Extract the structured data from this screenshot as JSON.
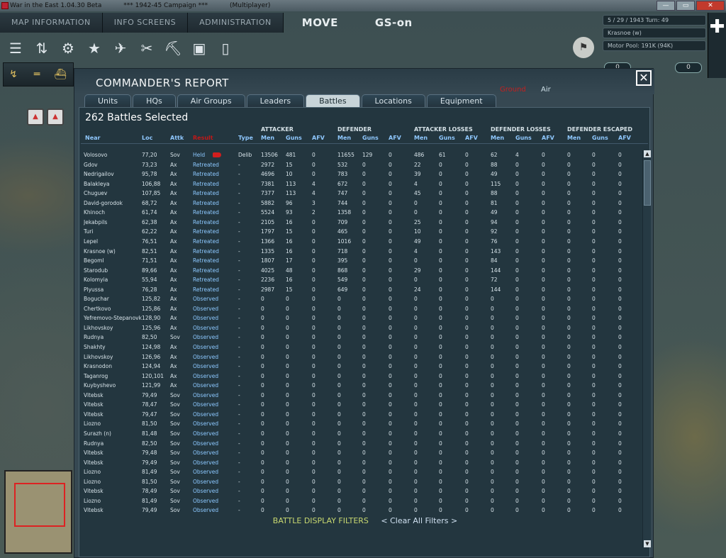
{
  "window": {
    "title": "War in the East 1.04.30 Beta",
    "campaign": "***   1942-45 Campaign   ***",
    "mode": "(Multiplayer)",
    "buttons": [
      "—",
      "▭",
      "✕"
    ]
  },
  "top_menu": {
    "tabs": [
      "MAP INFORMATION",
      "INFO SCREENS",
      "ADMINISTRATION"
    ],
    "move": "MOVE",
    "gs": "GS-on"
  },
  "info_panel": {
    "date_turn": "5 / 29 / 1943      Turn: 49",
    "location": "Krasnoe (w)",
    "motor_pool": "Motor Pool: 191K (94K)",
    "pill_left": "0",
    "pill_right": "0"
  },
  "toolbar_icons": [
    "list-icon",
    "sliders-icon",
    "gear-icon",
    "star-icon",
    "aircraft-icon",
    "supply-icon",
    "rail-icon",
    "card-icon",
    "document-icon"
  ],
  "dialog": {
    "title": "COMMANDER'S REPORT",
    "modes": {
      "ground": "Ground",
      "air": "Air"
    },
    "close": "✕",
    "tabs": [
      "Units",
      "HQs",
      "Air Groups",
      "Leaders",
      "Battles",
      "Locations",
      "Equipment"
    ],
    "active_tab": "Battles",
    "selected_count": "262 Battles Selected",
    "groups": {
      "attacker": "ATTACKER",
      "defender": "DEFENDER",
      "attacker_losses": "ATTACKER LOSSES",
      "defender_losses": "DEFENDER LOSSES",
      "defender_escaped": "DEFENDER ESCAPED"
    },
    "columns": {
      "near": "Near",
      "loc": "Loc",
      "attk": "Attk",
      "result": "Result",
      "type": "Type",
      "men": "Men",
      "guns": "Guns",
      "afv": "AFV"
    },
    "filters": {
      "display": "BATTLE DISPLAY FILTERS",
      "clear": "< Clear All Filters >"
    }
  },
  "battles": [
    [
      "Volosovo",
      "77,20",
      "Sov",
      "Held",
      "Delib",
      "13506",
      "481",
      "0",
      "11655",
      "129",
      "0",
      "486",
      "61",
      "0",
      "62",
      "4",
      "0",
      "0",
      "0",
      "0"
    ],
    [
      "Gdov",
      "73,23",
      "Ax",
      "Retreated",
      "-",
      "2972",
      "15",
      "0",
      "532",
      "0",
      "0",
      "22",
      "0",
      "0",
      "88",
      "0",
      "0",
      "0",
      "0",
      "0"
    ],
    [
      "Nedrigailov",
      "95,78",
      "Ax",
      "Retreated",
      "-",
      "4696",
      "10",
      "0",
      "783",
      "0",
      "0",
      "39",
      "0",
      "0",
      "49",
      "0",
      "0",
      "0",
      "0",
      "0"
    ],
    [
      "Balakleya",
      "106,88",
      "Ax",
      "Retreated",
      "-",
      "7381",
      "113",
      "4",
      "672",
      "0",
      "0",
      "4",
      "0",
      "0",
      "115",
      "0",
      "0",
      "0",
      "0",
      "0"
    ],
    [
      "Chuguev",
      "107,85",
      "Ax",
      "Retreated",
      "-",
      "7377",
      "113",
      "4",
      "747",
      "0",
      "0",
      "45",
      "0",
      "0",
      "88",
      "0",
      "0",
      "0",
      "0",
      "0"
    ],
    [
      "David-gorodok",
      "68,72",
      "Ax",
      "Retreated",
      "-",
      "5882",
      "96",
      "3",
      "744",
      "0",
      "0",
      "0",
      "0",
      "0",
      "81",
      "0",
      "0",
      "0",
      "0",
      "0"
    ],
    [
      "Khinoch",
      "61,74",
      "Ax",
      "Retreated",
      "-",
      "5524",
      "93",
      "2",
      "1358",
      "0",
      "0",
      "0",
      "0",
      "0",
      "49",
      "0",
      "0",
      "0",
      "0",
      "0"
    ],
    [
      "Jekabpils",
      "62,38",
      "Ax",
      "Retreated",
      "-",
      "2105",
      "16",
      "0",
      "709",
      "0",
      "0",
      "25",
      "0",
      "0",
      "94",
      "0",
      "0",
      "0",
      "0",
      "0"
    ],
    [
      "Turi",
      "62,22",
      "Ax",
      "Retreated",
      "-",
      "1797",
      "15",
      "0",
      "465",
      "0",
      "0",
      "10",
      "0",
      "0",
      "92",
      "0",
      "0",
      "0",
      "0",
      "0"
    ],
    [
      "Lepel",
      "76,51",
      "Ax",
      "Retreated",
      "-",
      "1366",
      "16",
      "0",
      "1016",
      "0",
      "0",
      "49",
      "0",
      "0",
      "76",
      "0",
      "0",
      "0",
      "0",
      "0"
    ],
    [
      "Krasnoe (w)",
      "82,51",
      "Ax",
      "Retreated",
      "-",
      "1335",
      "16",
      "0",
      "718",
      "0",
      "0",
      "4",
      "0",
      "0",
      "143",
      "0",
      "0",
      "0",
      "0",
      "0"
    ],
    [
      "Begoml",
      "71,51",
      "Ax",
      "Retreated",
      "-",
      "1807",
      "17",
      "0",
      "395",
      "0",
      "0",
      "0",
      "0",
      "0",
      "84",
      "0",
      "0",
      "0",
      "0",
      "0"
    ],
    [
      "Starodub",
      "89,66",
      "Ax",
      "Retreated",
      "-",
      "4025",
      "48",
      "0",
      "868",
      "0",
      "0",
      "29",
      "0",
      "0",
      "144",
      "0",
      "0",
      "0",
      "0",
      "0"
    ],
    [
      "Kolomyia",
      "55,94",
      "Ax",
      "Retreated",
      "-",
      "2236",
      "16",
      "0",
      "549",
      "0",
      "0",
      "0",
      "0",
      "0",
      "72",
      "0",
      "0",
      "0",
      "0",
      "0"
    ],
    [
      "Plyussa",
      "76,28",
      "Ax",
      "Retreated",
      "-",
      "2987",
      "15",
      "0",
      "649",
      "0",
      "0",
      "24",
      "0",
      "0",
      "144",
      "0",
      "0",
      "0",
      "0",
      "0"
    ],
    [
      "Boguchar",
      "125,82",
      "Ax",
      "Observed",
      "-",
      "0",
      "0",
      "0",
      "0",
      "0",
      "0",
      "0",
      "0",
      "0",
      "0",
      "0",
      "0",
      "0",
      "0",
      "0"
    ],
    [
      "Chertkovo",
      "125,86",
      "Ax",
      "Observed",
      "-",
      "0",
      "0",
      "0",
      "0",
      "0",
      "0",
      "0",
      "0",
      "0",
      "0",
      "0",
      "0",
      "0",
      "0",
      "0"
    ],
    [
      "Yefremovo-Stepanovka",
      "128,90",
      "Ax",
      "Observed",
      "-",
      "0",
      "0",
      "0",
      "0",
      "0",
      "0",
      "0",
      "0",
      "0",
      "0",
      "0",
      "0",
      "0",
      "0",
      "0"
    ],
    [
      "Likhovskoy",
      "125,96",
      "Ax",
      "Observed",
      "-",
      "0",
      "0",
      "0",
      "0",
      "0",
      "0",
      "0",
      "0",
      "0",
      "0",
      "0",
      "0",
      "0",
      "0",
      "0"
    ],
    [
      "Rudnya",
      "82,50",
      "Sov",
      "Observed",
      "-",
      "0",
      "0",
      "0",
      "0",
      "0",
      "0",
      "0",
      "0",
      "0",
      "0",
      "0",
      "0",
      "0",
      "0",
      "0"
    ],
    [
      "Shakhty",
      "124,98",
      "Ax",
      "Observed",
      "-",
      "0",
      "0",
      "0",
      "0",
      "0",
      "0",
      "0",
      "0",
      "0",
      "0",
      "0",
      "0",
      "0",
      "0",
      "0"
    ],
    [
      "Likhovskoy",
      "126,96",
      "Ax",
      "Observed",
      "-",
      "0",
      "0",
      "0",
      "0",
      "0",
      "0",
      "0",
      "0",
      "0",
      "0",
      "0",
      "0",
      "0",
      "0",
      "0"
    ],
    [
      "Krasnodon",
      "124,94",
      "Ax",
      "Observed",
      "-",
      "0",
      "0",
      "0",
      "0",
      "0",
      "0",
      "0",
      "0",
      "0",
      "0",
      "0",
      "0",
      "0",
      "0",
      "0"
    ],
    [
      "Taganrog",
      "120,101",
      "Ax",
      "Observed",
      "-",
      "0",
      "0",
      "0",
      "0",
      "0",
      "0",
      "0",
      "0",
      "0",
      "0",
      "0",
      "0",
      "0",
      "0",
      "0"
    ],
    [
      "Kuybyshevo",
      "121,99",
      "Ax",
      "Observed",
      "-",
      "0",
      "0",
      "0",
      "0",
      "0",
      "0",
      "0",
      "0",
      "0",
      "0",
      "0",
      "0",
      "0",
      "0",
      "0"
    ],
    [
      "Vitebsk",
      "79,49",
      "Sov",
      "Observed",
      "-",
      "0",
      "0",
      "0",
      "0",
      "0",
      "0",
      "0",
      "0",
      "0",
      "0",
      "0",
      "0",
      "0",
      "0",
      "0"
    ],
    [
      "Vitebsk",
      "78,47",
      "Sov",
      "Observed",
      "-",
      "0",
      "0",
      "0",
      "0",
      "0",
      "0",
      "0",
      "0",
      "0",
      "0",
      "0",
      "0",
      "0",
      "0",
      "0"
    ],
    [
      "Vitebsk",
      "79,47",
      "Sov",
      "Observed",
      "-",
      "0",
      "0",
      "0",
      "0",
      "0",
      "0",
      "0",
      "0",
      "0",
      "0",
      "0",
      "0",
      "0",
      "0",
      "0"
    ],
    [
      "Liozno",
      "81,50",
      "Sov",
      "Observed",
      "-",
      "0",
      "0",
      "0",
      "0",
      "0",
      "0",
      "0",
      "0",
      "0",
      "0",
      "0",
      "0",
      "0",
      "0",
      "0"
    ],
    [
      "Surazh (n)",
      "81,48",
      "Sov",
      "Observed",
      "-",
      "0",
      "0",
      "0",
      "0",
      "0",
      "0",
      "0",
      "0",
      "0",
      "0",
      "0",
      "0",
      "0",
      "0",
      "0"
    ],
    [
      "Rudnya",
      "82,50",
      "Sov",
      "Observed",
      "-",
      "0",
      "0",
      "0",
      "0",
      "0",
      "0",
      "0",
      "0",
      "0",
      "0",
      "0",
      "0",
      "0",
      "0",
      "0"
    ],
    [
      "Vitebsk",
      "79,48",
      "Sov",
      "Observed",
      "-",
      "0",
      "0",
      "0",
      "0",
      "0",
      "0",
      "0",
      "0",
      "0",
      "0",
      "0",
      "0",
      "0",
      "0",
      "0"
    ],
    [
      "Vitebsk",
      "79,49",
      "Sov",
      "Observed",
      "-",
      "0",
      "0",
      "0",
      "0",
      "0",
      "0",
      "0",
      "0",
      "0",
      "0",
      "0",
      "0",
      "0",
      "0",
      "0"
    ],
    [
      "Liozno",
      "81,49",
      "Sov",
      "Observed",
      "-",
      "0",
      "0",
      "0",
      "0",
      "0",
      "0",
      "0",
      "0",
      "0",
      "0",
      "0",
      "0",
      "0",
      "0",
      "0"
    ],
    [
      "Liozno",
      "81,50",
      "Sov",
      "Observed",
      "-",
      "0",
      "0",
      "0",
      "0",
      "0",
      "0",
      "0",
      "0",
      "0",
      "0",
      "0",
      "0",
      "0",
      "0",
      "0"
    ],
    [
      "Vitebsk",
      "78,49",
      "Sov",
      "Observed",
      "-",
      "0",
      "0",
      "0",
      "0",
      "0",
      "0",
      "0",
      "0",
      "0",
      "0",
      "0",
      "0",
      "0",
      "0",
      "0"
    ],
    [
      "Liozno",
      "81,49",
      "Sov",
      "Observed",
      "-",
      "0",
      "0",
      "0",
      "0",
      "0",
      "0",
      "0",
      "0",
      "0",
      "0",
      "0",
      "0",
      "0",
      "0",
      "0"
    ],
    [
      "Vitebsk",
      "79,49",
      "Sov",
      "Observed",
      "-",
      "0",
      "0",
      "0",
      "0",
      "0",
      "0",
      "0",
      "0",
      "0",
      "0",
      "0",
      "0",
      "0",
      "0",
      "0"
    ]
  ]
}
